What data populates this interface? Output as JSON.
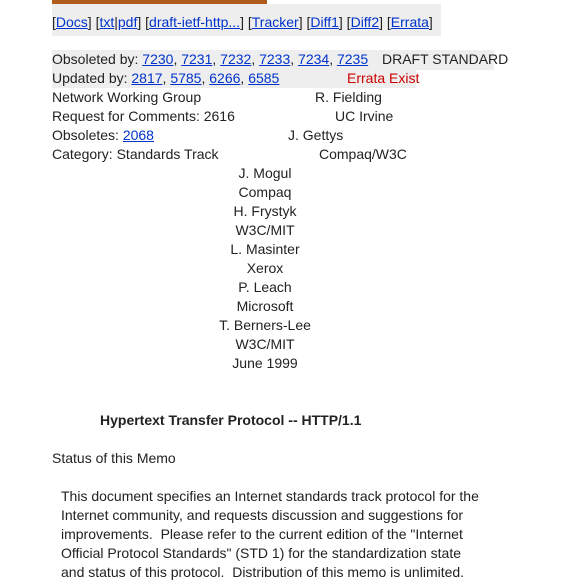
{
  "nav": {
    "docs": "Docs",
    "txt": "txt",
    "pdf": "pdf",
    "draft": "draft-ietf-http...",
    "tracker": "Tracker",
    "diff1": "Diff1",
    "diff2": "Diff2",
    "errata": "Errata"
  },
  "meta": {
    "obsoleted_label": "Obsoleted by:",
    "obsoleted_by": [
      "7230",
      "7231",
      "7232",
      "7233",
      "7234",
      "7235"
    ],
    "draft_status": "DRAFT STANDARD",
    "updated_label": "Updated by:",
    "updated_by": [
      "2817",
      "5785",
      "6266",
      "6585"
    ],
    "errata_exist": "Errata Exist"
  },
  "header": {
    "group": "Network Working Group",
    "rfc": "Request for Comments: 2616",
    "obsoletes_label": "Obsoletes:",
    "obsoletes": "2068",
    "category": "Category: Standards Track",
    "authors_right": [
      "R. Fielding",
      "UC Irvine",
      "J. Gettys",
      "Compaq/W3C"
    ],
    "authors_center": [
      "J. Mogul",
      "Compaq",
      "H. Frystyk",
      "W3C/MIT",
      "L. Masinter",
      "Xerox",
      "P. Leach",
      "Microsoft",
      "T. Berners-Lee",
      "W3C/MIT",
      "June 1999"
    ]
  },
  "title": "Hypertext Transfer Protocol -- HTTP/1.1",
  "status_heading": "Status of this Memo",
  "status_paragraph": [
    "This document specifies an Internet standards track protocol for the",
    "Internet community, and requests discussion and suggestions for",
    "improvements.  Please refer to the current edition of the \"Internet",
    "Official Protocol Standards\" (STD 1) for the standardization state",
    "and status of this protocol.  Distribution of this memo is unlimited."
  ]
}
